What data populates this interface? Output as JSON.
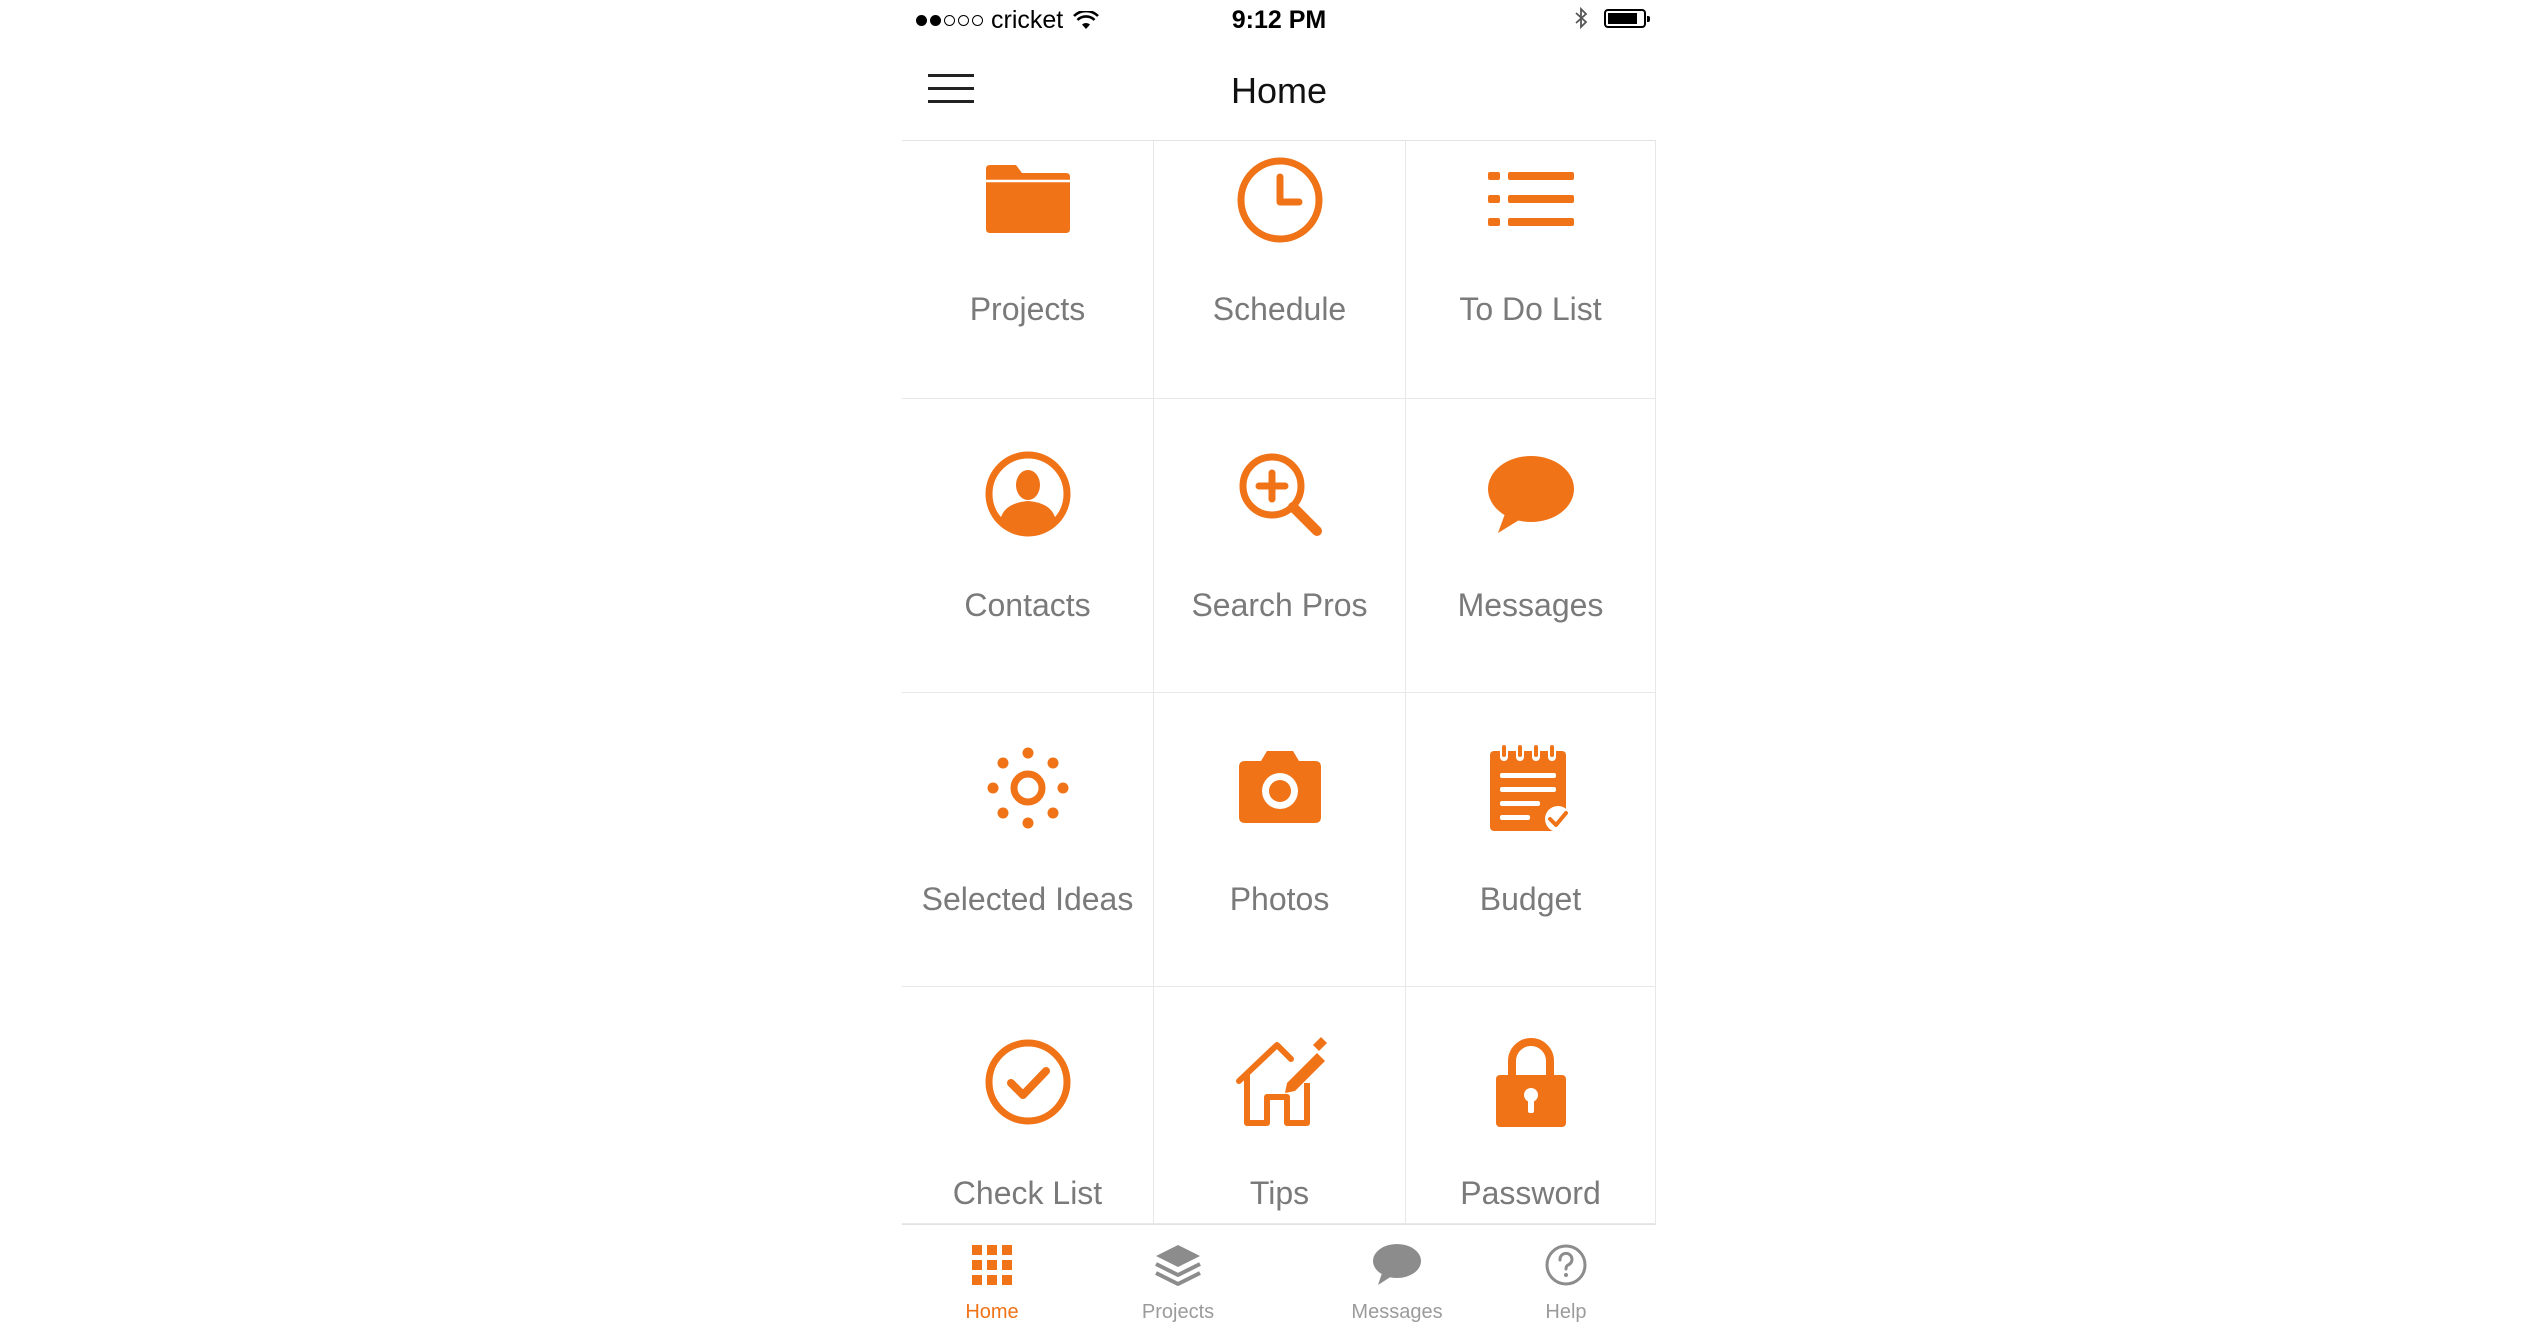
{
  "status_bar": {
    "carrier": "cricket",
    "time": "9:12 PM",
    "signal_bars_filled": 2,
    "signal_bars_total": 5,
    "icons": [
      "wifi-icon",
      "bluetooth-icon",
      "battery-icon"
    ],
    "battery_level": 0.85
  },
  "header": {
    "title": "Home",
    "menu_icon": "hamburger-menu-icon"
  },
  "accent_color": "#F07318",
  "tiles": [
    {
      "label": "Projects",
      "icon": "folder-icon"
    },
    {
      "label": "Schedule",
      "icon": "clock-icon"
    },
    {
      "label": "To Do List",
      "icon": "list-icon"
    },
    {
      "label": "Contacts",
      "icon": "contact-icon"
    },
    {
      "label": "Search Pros",
      "icon": "search-plus-icon"
    },
    {
      "label": "Messages",
      "icon": "speech-bubble-icon"
    },
    {
      "label": "Selected Ideas",
      "icon": "sun-icon"
    },
    {
      "label": "Photos",
      "icon": "camera-icon"
    },
    {
      "label": "Budget",
      "icon": "notepad-check-icon"
    },
    {
      "label": "Check List",
      "icon": "check-circle-icon"
    },
    {
      "label": "Tips",
      "icon": "house-pencil-icon"
    },
    {
      "label": "Password",
      "icon": "padlock-icon"
    }
  ],
  "tab_bar": {
    "active": "Home",
    "tabs": [
      {
        "label": "Home",
        "icon": "grid-icon"
      },
      {
        "label": "Projects",
        "icon": "layers-icon"
      },
      {
        "label": "Messages",
        "icon": "speech-bubble-icon"
      },
      {
        "label": "Help",
        "icon": "help-circle-icon"
      }
    ]
  }
}
